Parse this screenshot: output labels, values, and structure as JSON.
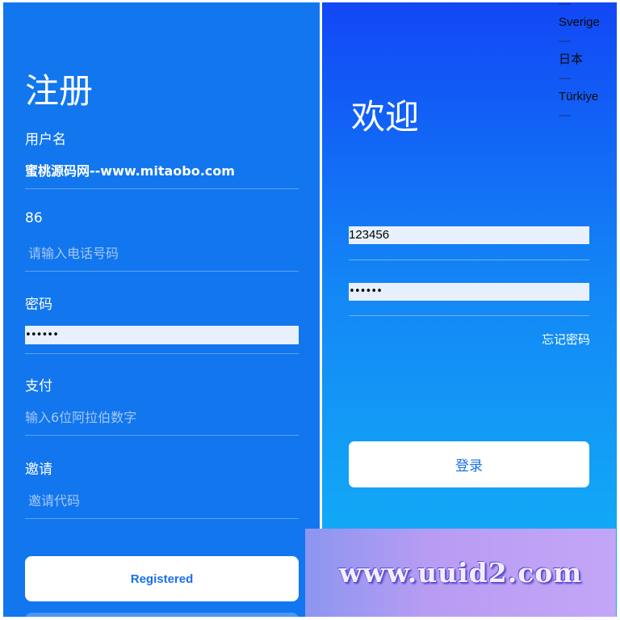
{
  "register": {
    "title": "注册",
    "fields": {
      "username": {
        "label": "用户名",
        "value": "蜜桃源码网--www.mitaobo.com"
      },
      "phone": {
        "label": "86",
        "placeholder": "请输入电话号码"
      },
      "password": {
        "label": "密码",
        "value": "••••••"
      },
      "payment": {
        "label": "支付",
        "placeholder": "输入6位阿拉伯数字"
      },
      "invite": {
        "label": "邀请",
        "placeholder": "邀请代码"
      }
    },
    "submit_label": "Registered"
  },
  "login": {
    "title": "欢迎",
    "account_value": "123456",
    "password_value": "••••••",
    "forgot_label": "忘记密码",
    "submit_label": "登录"
  },
  "languages": {
    "separator": "----",
    "items": [
      "Sverige",
      "日本",
      "Türkiye"
    ]
  },
  "watermark": {
    "text": "www.uuid2.com"
  },
  "colors": {
    "left_panel": "#1276ee",
    "right_gradient_top": "#1247f5",
    "right_gradient_bottom": "#12b5f7",
    "button_text": "#1a6fea"
  }
}
